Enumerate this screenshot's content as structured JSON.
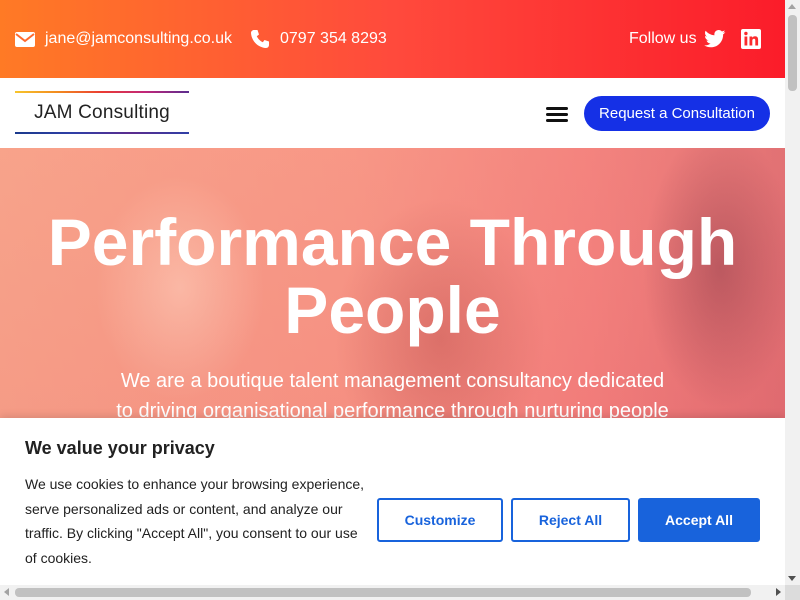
{
  "topbar": {
    "email": "jane@jamconsulting.co.uk",
    "phone": "0797 354 8293",
    "follow_label": "Follow us",
    "icons": [
      "envelope-icon",
      "phone-icon",
      "twitter-icon",
      "linkedin-icon"
    ]
  },
  "header": {
    "logo_text": "JAM Consulting",
    "cta_label": "Request a Consultation",
    "menu_icon": "hamburger-menu-icon"
  },
  "hero": {
    "title_line1": "Performance Through",
    "title_line2": "People",
    "subtitle": "We are a boutique talent management consultancy dedicated to driving organisational performance through nurturing people"
  },
  "cookie_banner": {
    "title": "We value your privacy",
    "body": "We use cookies to enhance your browsing experience, serve personalized ads or content, and analyze our traffic. By clicking \"Accept All\", you consent to our use of cookies.",
    "customize_label": "Customize",
    "reject_label": "Reject All",
    "accept_label": "Accept All"
  },
  "colors": {
    "topbar_gradient_start": "#ff7a25",
    "topbar_gradient_end": "#fb1c2a",
    "cta_blue": "#1530e6",
    "cookie_blue": "#1863dc"
  }
}
